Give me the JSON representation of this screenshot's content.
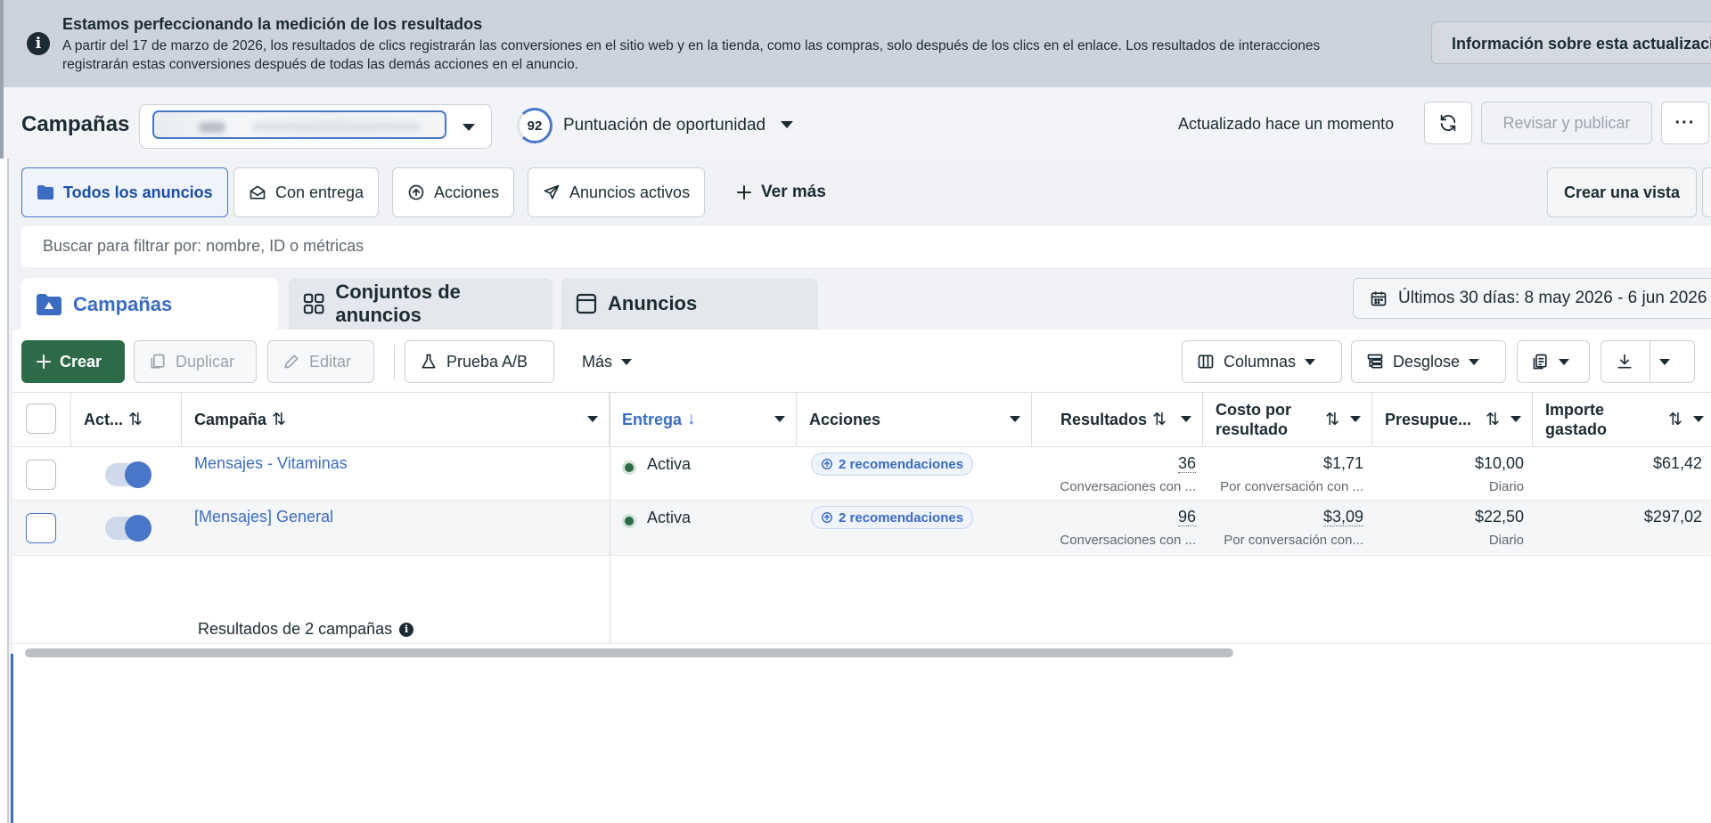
{
  "banner": {
    "title": "Estamos perfeccionando la medición de los resultados",
    "text": "A partir del 17 de marzo de 2026, los resultados de clics registrarán las conversiones en el sitio web y en la tienda, como las compras, solo después de los clics en el enlace. Los resultados de interacciones registrarán estas conversiones después de todas las demás acciones en el anuncio.",
    "button": "Información sobre esta actualización"
  },
  "header": {
    "title": "Campañas",
    "opportunity_score": "92",
    "opportunity_label": "Puntuación de oportunidad",
    "updated": "Actualizado hace un momento",
    "review_publish": "Revisar y publicar"
  },
  "filters": {
    "all_ads": "Todos los anuncios",
    "delivering": "Con entrega",
    "actions": "Acciones",
    "active_ads": "Anuncios activos",
    "see_more": "Ver más",
    "create_view": "Crear una vista"
  },
  "search": {
    "placeholder": "Buscar para filtrar por: nombre, ID o métricas"
  },
  "level_tabs": {
    "campaigns": "Campañas",
    "ad_sets": "Conjuntos de anuncios",
    "ads": "Anuncios"
  },
  "date_range": "Últimos 30 días: 8 may 2026 - 6 jun 2026",
  "toolbar": {
    "create": "Crear",
    "duplicate": "Duplicar",
    "edit": "Editar",
    "ab_test": "Prueba A/B",
    "more": "Más",
    "columns": "Columnas",
    "breakdown": "Desglose"
  },
  "columns": {
    "active": "Act...",
    "campaign": "Campaña",
    "delivery": "Entrega",
    "actions": "Acciones",
    "results": "Resultados",
    "cost_line1": "Costo por",
    "cost_line2": "resultado",
    "budget": "Presupue...",
    "spent_line1": "Importe",
    "spent_line2": "gastado"
  },
  "rows": [
    {
      "name": "Mensajes - Vitaminas",
      "delivery": "Activa",
      "recommendations": "2 recomendaciones",
      "results": "36",
      "results_sub": "Conversaciones con ...",
      "cost": "$1,71",
      "cost_sub": "Por conversación con ...",
      "budget": "$10,00",
      "budget_sub": "Diario",
      "spent": "$61,42"
    },
    {
      "name": "[Mensajes] General",
      "delivery": "Activa",
      "recommendations": "2 recomendaciones",
      "results": "96",
      "results_sub": "Conversaciones con ...",
      "cost": "$3,09",
      "cost_sub": "Por conversación con...",
      "budget": "$22,50",
      "budget_sub": "Diario",
      "spent": "$297,02"
    }
  ],
  "footer": {
    "summary": "Resultados de 2 campañas"
  },
  "colors": {
    "accent": "#3b6cc2",
    "create_green": "#2d6a47",
    "banner_bg": "#cdd3dc"
  }
}
